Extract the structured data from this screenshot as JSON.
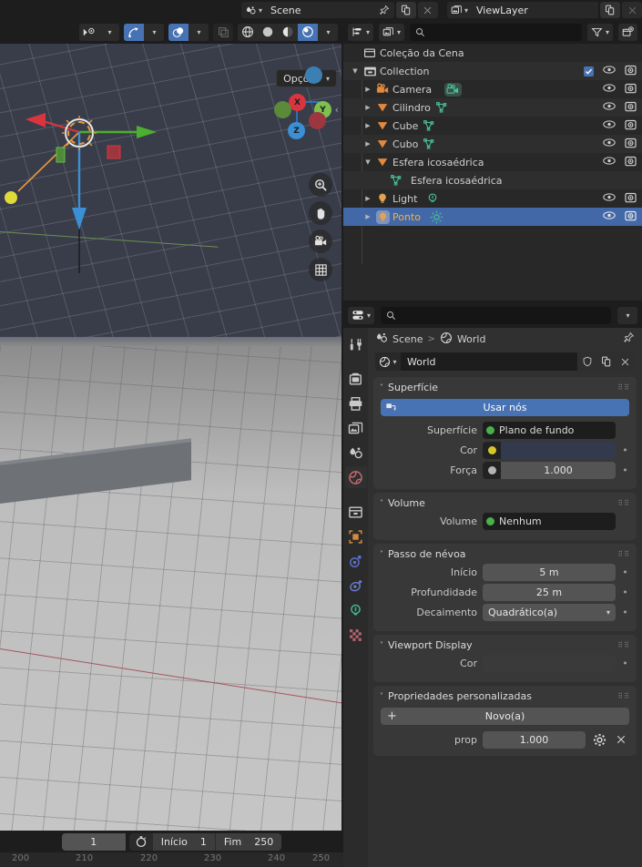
{
  "topbar": {
    "scene": {
      "name": "Scene",
      "icon": "scene-icon",
      "pin": "pin-icon",
      "copy": "new-scene-icon",
      "close": "unlink-icon"
    },
    "viewlayer": {
      "name": "ViewLayer",
      "icon": "viewlayer-icon",
      "copy": "new-viewlayer-icon",
      "close": "remove-viewlayer-icon"
    }
  },
  "viewport": {
    "header": {
      "visibility_label": "object-visibility-dropdown",
      "gizmo_label": "gizmos-toggle",
      "overlays_label": "overlays-toggle",
      "xray_label": "xray-toggle",
      "shading": [
        "wireframe",
        "solid",
        "material-preview",
        "rendered"
      ]
    },
    "options_button": "Opções",
    "gizmo": {
      "x": "X",
      "y": "Y",
      "z": "Z"
    },
    "tools": [
      "zoom-icon",
      "pan-icon",
      "camera-view-icon",
      "grid-toggle-icon"
    ]
  },
  "outliner": {
    "header": {
      "display_mode": "view-layer-display-mode",
      "filter_id": "id-type-filter",
      "search_placeholder": "",
      "filter": "filter-icon",
      "new_collection": "new-collection-icon"
    },
    "rows": [
      {
        "label": "Coleção da Cena",
        "icon": "scene-collection-icon",
        "indent": 0,
        "disclosure": "",
        "data": "",
        "checkbox": false,
        "eye": false,
        "camera": false,
        "selected": false
      },
      {
        "label": "Collection",
        "icon": "collection-icon",
        "indent": 1,
        "disclosure": "down",
        "data": "",
        "checkbox": true,
        "eye": true,
        "camera": true,
        "selected": false
      },
      {
        "label": "Camera",
        "icon": "camera-object-icon",
        "indent": 2,
        "disclosure": "right",
        "data": "camera-data-icon",
        "checkbox": false,
        "eye": true,
        "camera": true,
        "selected": false
      },
      {
        "label": "Cilindro",
        "icon": "mesh-object-icon",
        "indent": 2,
        "disclosure": "right",
        "data": "mesh-data-icon",
        "checkbox": false,
        "eye": true,
        "camera": true,
        "selected": false
      },
      {
        "label": "Cube",
        "icon": "mesh-object-icon",
        "indent": 2,
        "disclosure": "right",
        "data": "mesh-data-icon",
        "checkbox": false,
        "eye": true,
        "camera": true,
        "selected": false
      },
      {
        "label": "Cubo",
        "icon": "mesh-object-icon",
        "indent": 2,
        "disclosure": "right",
        "data": "mesh-data-icon",
        "checkbox": false,
        "eye": true,
        "camera": true,
        "selected": false
      },
      {
        "label": "Esfera icosaédrica",
        "icon": "mesh-object-icon",
        "indent": 2,
        "disclosure": "down",
        "data": "",
        "checkbox": false,
        "eye": true,
        "camera": true,
        "selected": false
      },
      {
        "label": "Esfera icosaédrica",
        "icon": "mesh-data-icon",
        "indent": 3,
        "disclosure": "",
        "data": "",
        "checkbox": false,
        "eye": false,
        "camera": false,
        "selected": false
      },
      {
        "label": "Light",
        "icon": "light-object-icon",
        "indent": 2,
        "disclosure": "right",
        "data": "light-data-icon",
        "checkbox": false,
        "eye": true,
        "camera": true,
        "selected": false
      },
      {
        "label": "Ponto",
        "icon": "light-object-icon",
        "indent": 2,
        "disclosure": "right",
        "data": "point-light-data-icon",
        "checkbox": false,
        "eye": true,
        "camera": true,
        "selected": true
      }
    ]
  },
  "properties": {
    "header": {
      "editor_type": "properties-editor-icon",
      "search_placeholder": "",
      "options_dropdown": "options-dropdown-icon"
    },
    "tabs": [
      {
        "name": "tool",
        "icon": "tool-icon",
        "active": false
      },
      {
        "name": "render",
        "icon": "render-icon",
        "active": false
      },
      {
        "name": "output",
        "icon": "output-icon",
        "active": false
      },
      {
        "name": "view-layer",
        "icon": "view-layer-icon",
        "active": false
      },
      {
        "name": "scene",
        "icon": "scene-props-icon",
        "active": false
      },
      {
        "name": "world",
        "icon": "world-icon",
        "active": true
      },
      {
        "name": "collection",
        "icon": "collection-props-icon",
        "active": false
      },
      {
        "name": "object",
        "icon": "object-props-icon",
        "active": false
      },
      {
        "name": "modifiers",
        "icon": "physics-icon",
        "active": false
      },
      {
        "name": "particles",
        "icon": "particles-icon",
        "active": false
      },
      {
        "name": "object-data",
        "icon": "light-data-props-icon",
        "active": false
      },
      {
        "name": "texture",
        "icon": "texture-icon",
        "active": false
      }
    ],
    "breadcrumb": {
      "scene": "Scene",
      "separator": ">",
      "world": "World",
      "pin": "pin-icon"
    },
    "id_block": {
      "name": "World",
      "browse": "browse-world-icon",
      "fake_user": "shield-icon",
      "new": "new-world-icon",
      "unlink": "unlink-icon"
    },
    "panels": [
      {
        "title": "Superfície",
        "use_nodes_button": "Usar nós",
        "rows": [
          {
            "label": "Superfície",
            "value": "Plano de fundo",
            "type": "dropdown",
            "swatch": "#4bb04b",
            "anim": false
          },
          {
            "label": "Cor",
            "value": "",
            "type": "color",
            "swatch": "#d6c62e",
            "color": "#333a4d",
            "anim": true
          },
          {
            "label": "Força",
            "value": "1.000",
            "type": "value",
            "swatch": "#b4b4b4",
            "anim": true
          }
        ]
      },
      {
        "title": "Volume",
        "rows": [
          {
            "label": "Volume",
            "value": "Nenhum",
            "type": "dropdown",
            "swatch": "#4bb04b",
            "anim": false
          }
        ]
      },
      {
        "title": "Passo de névoa",
        "rows": [
          {
            "label": "Início",
            "value": "5 m",
            "type": "value",
            "anim": true
          },
          {
            "label": "Profundidade",
            "value": "25 m",
            "type": "value",
            "anim": true
          },
          {
            "label": "Decaimento",
            "value": "Quadrático(a)",
            "type": "enum",
            "anim": true
          }
        ]
      },
      {
        "title": "Viewport Display",
        "rows": [
          {
            "label": "Cor",
            "value": "",
            "type": "color2",
            "color": "#3a3a3a",
            "anim": true
          }
        ]
      },
      {
        "title": "Propriedades personalizadas",
        "new_button": "Novo(a)",
        "custom_prop": {
          "label": "prop",
          "value": "1.000",
          "edit": "gear-icon",
          "remove": "close-icon"
        }
      }
    ]
  },
  "timeline": {
    "current_frame": "1",
    "auto_key": "auto-keying-icon",
    "start_label": "Início",
    "start_value": "1",
    "end_label": "Fim",
    "end_value": "250",
    "ruler_ticks": [
      "200",
      "210",
      "220",
      "230",
      "240",
      "250"
    ]
  }
}
